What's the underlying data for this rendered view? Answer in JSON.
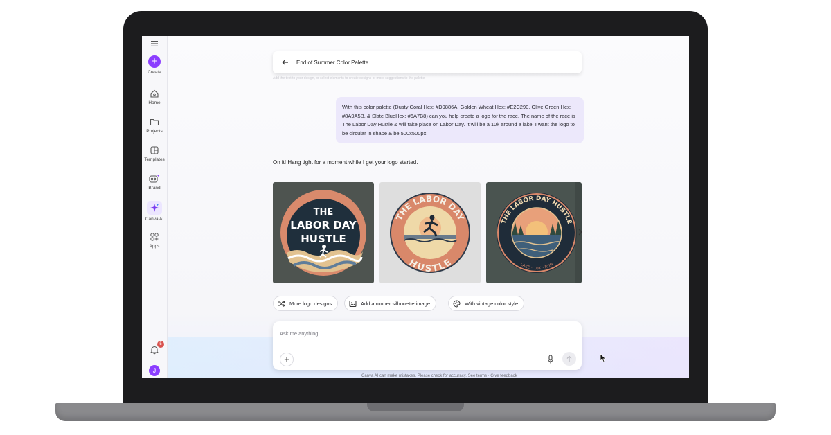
{
  "sidebar": {
    "items": [
      {
        "label": "Create",
        "icon": "plus-icon"
      },
      {
        "label": "Home",
        "icon": "home-icon"
      },
      {
        "label": "Projects",
        "icon": "folder-icon"
      },
      {
        "label": "Templates",
        "icon": "templates-icon"
      },
      {
        "label": "Brand",
        "icon": "brand-icon"
      },
      {
        "label": "Canva AI",
        "icon": "sparkle-icon"
      },
      {
        "label": "Apps",
        "icon": "apps-icon"
      }
    ],
    "notification_count": "5",
    "avatar_initial": "J"
  },
  "chat": {
    "title": "End of Summer Color Palette",
    "faded_text": "Add the text to your design, or select elements to create designs or more suggestions to the palette",
    "user_message": "With this color palette (Dusty Coral Hex: #D9886A, Golden Wheat Hex: #E2C290, Olive Green Hex: #8A9A5B, & Slate BlueHex: #6A7B8) can you help create a logo for the race. The name of the race is The Labor Day Hustle & will take place on Labor Day. It will be a 10k around a lake. I want the logo to be circular in shape & be 500x500px.",
    "assistant_message": "On it! Hang tight for a moment while I get your logo started.",
    "logos": [
      {
        "line1": "THE",
        "line2": "LABOR DAY",
        "line3": "HUSTLE"
      },
      {
        "arc_top": "THE LABOR DAY",
        "arc_bottom": "HUSTLE"
      },
      {
        "arc_top": "THE LABOR DAY HUSTLE",
        "arc_bottom": "LAKE · 10K · RUN"
      }
    ],
    "suggestions": [
      {
        "label": "More logo designs",
        "icon": "shuffle-icon"
      },
      {
        "label": "Add a runner silhouette image",
        "icon": "image-icon"
      },
      {
        "label": "With vintage color style",
        "icon": "palette-icon"
      }
    ],
    "composer_placeholder": "Ask me anything",
    "disclaimer": "Canva AI can make mistakes. Please check for accuracy. See terms · Give feedback"
  },
  "colors": {
    "accent": "#8b3dff",
    "coral": "#D9886A",
    "wheat": "#E2C290",
    "olive": "#8A9A5B",
    "slate": "#6A7B8B"
  }
}
